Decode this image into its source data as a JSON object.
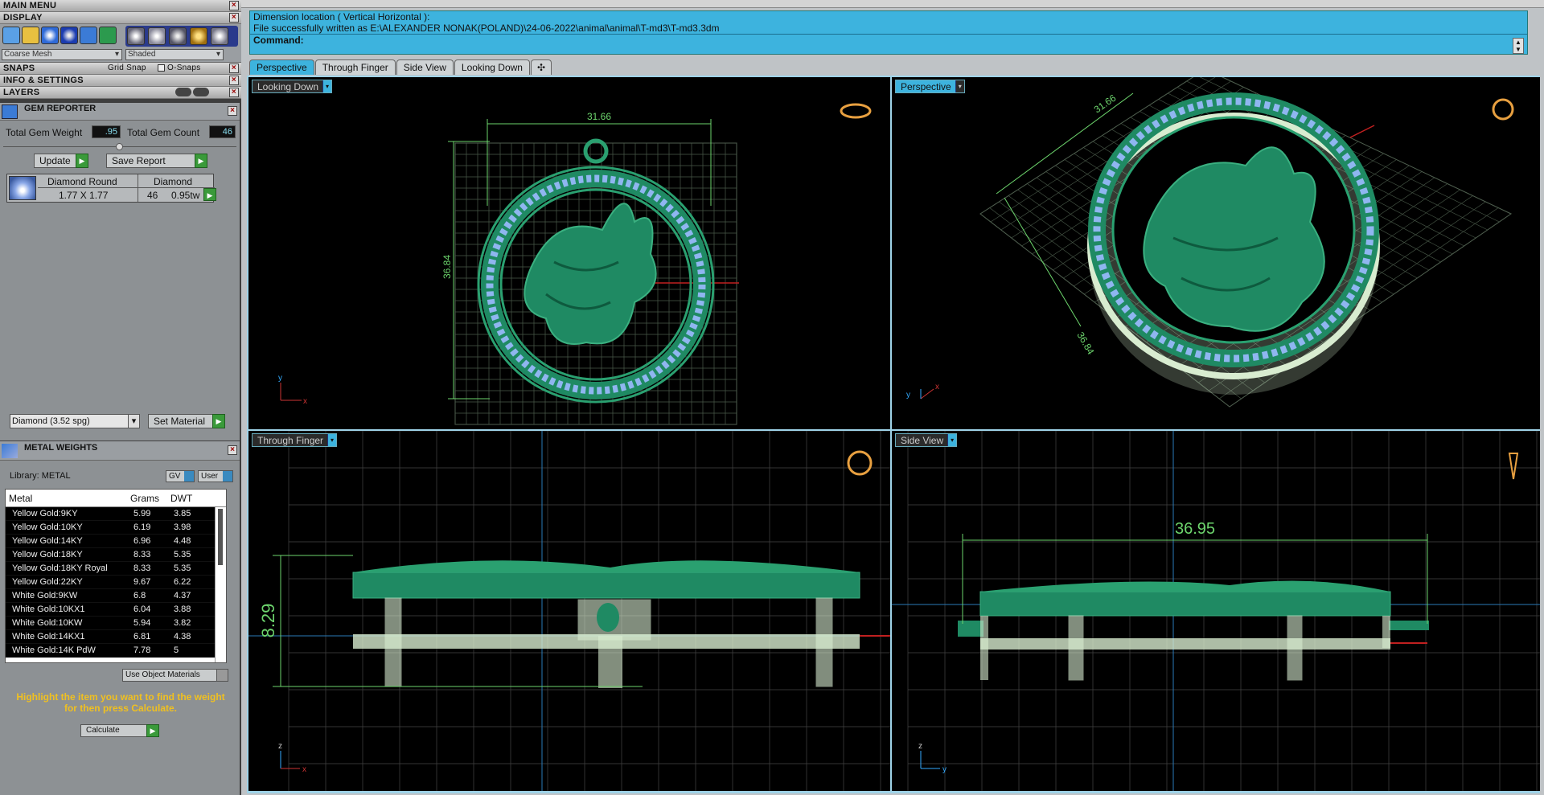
{
  "left": {
    "main_menu": "MAIN MENU",
    "display": "DISPLAY",
    "mesh_select": "Coarse Mesh",
    "shade_select": "Shaded",
    "snaps": "SNAPS",
    "grid_snap": "Grid Snap",
    "o_snaps": "O-Snaps",
    "info_settings": "INFO & SETTINGS",
    "layers": "LAYERS",
    "gem_reporter": "GEM REPORTER",
    "total_gem_weight_label": "Total Gem Weight",
    "total_gem_weight_value": ".95",
    "total_gem_count_label": "Total Gem Count",
    "total_gem_count_value": "46",
    "update_label": "Update",
    "save_report_label": "Save Report",
    "gem_row": {
      "name": "Diamond Round",
      "material": "Diamond",
      "size": "1.77 X 1.77",
      "count": "46",
      "weight": "0.95tw"
    },
    "material_select": "Diamond    (3.52 spg)",
    "set_material_label": "Set Material",
    "metal_weights": "METAL WEIGHTS",
    "library": "Library: METAL",
    "gv_label": "GV",
    "user_label": "User",
    "metal_table": {
      "headers": [
        "Metal",
        "Grams",
        "DWT"
      ],
      "rows": [
        [
          "Yellow Gold:9KY",
          "5.99",
          "3.85"
        ],
        [
          "Yellow Gold:10KY",
          "6.19",
          "3.98"
        ],
        [
          "Yellow Gold:14KY",
          "6.96",
          "4.48"
        ],
        [
          "Yellow Gold:18KY",
          "8.33",
          "5.35"
        ],
        [
          "Yellow Gold:18KY Royal",
          "8.33",
          "5.35"
        ],
        [
          "Yellow Gold:22KY",
          "9.67",
          "6.22"
        ],
        [
          "White Gold:9KW",
          "6.8",
          "4.37"
        ],
        [
          "White Gold:10KX1",
          "6.04",
          "3.88"
        ],
        [
          "White Gold:10KW",
          "5.94",
          "3.82"
        ],
        [
          "White Gold:14KX1",
          "6.81",
          "4.38"
        ],
        [
          "White Gold:14K PdW",
          "7.78",
          "5"
        ]
      ]
    },
    "use_object_materials": "Use Object Materials",
    "help_text": "Highlight the item you want to find the weight for then press Calculate.",
    "calculate_label": "Calculate"
  },
  "command": {
    "line1": "Dimension location ( Vertical  Horizontal ):",
    "line2": "File successfully written as E:\\ALEXANDER NONAK(POLAND)\\24-06-2022\\animal\\animal\\T-md3\\T-md3.3dm",
    "prompt": "Command:"
  },
  "tabs": [
    "Perspective",
    "Through Finger",
    "Side View",
    "Looking Down"
  ],
  "viewports": {
    "looking_down": {
      "title": "Looking Down",
      "dim_h": "31.66",
      "dim_v": "36.84"
    },
    "perspective": {
      "title": "Perspective",
      "dim_a": "31.66",
      "dim_b": "36.84"
    },
    "through_finger": {
      "title": "Through Finger",
      "dim": "8.29"
    },
    "side_view": {
      "title": "Side View",
      "dim": "36.95"
    }
  },
  "colors": {
    "accent": "#3db3de",
    "model": "#1f8a63",
    "gem": "#8fb6f0",
    "dim": "#6dd56d"
  }
}
